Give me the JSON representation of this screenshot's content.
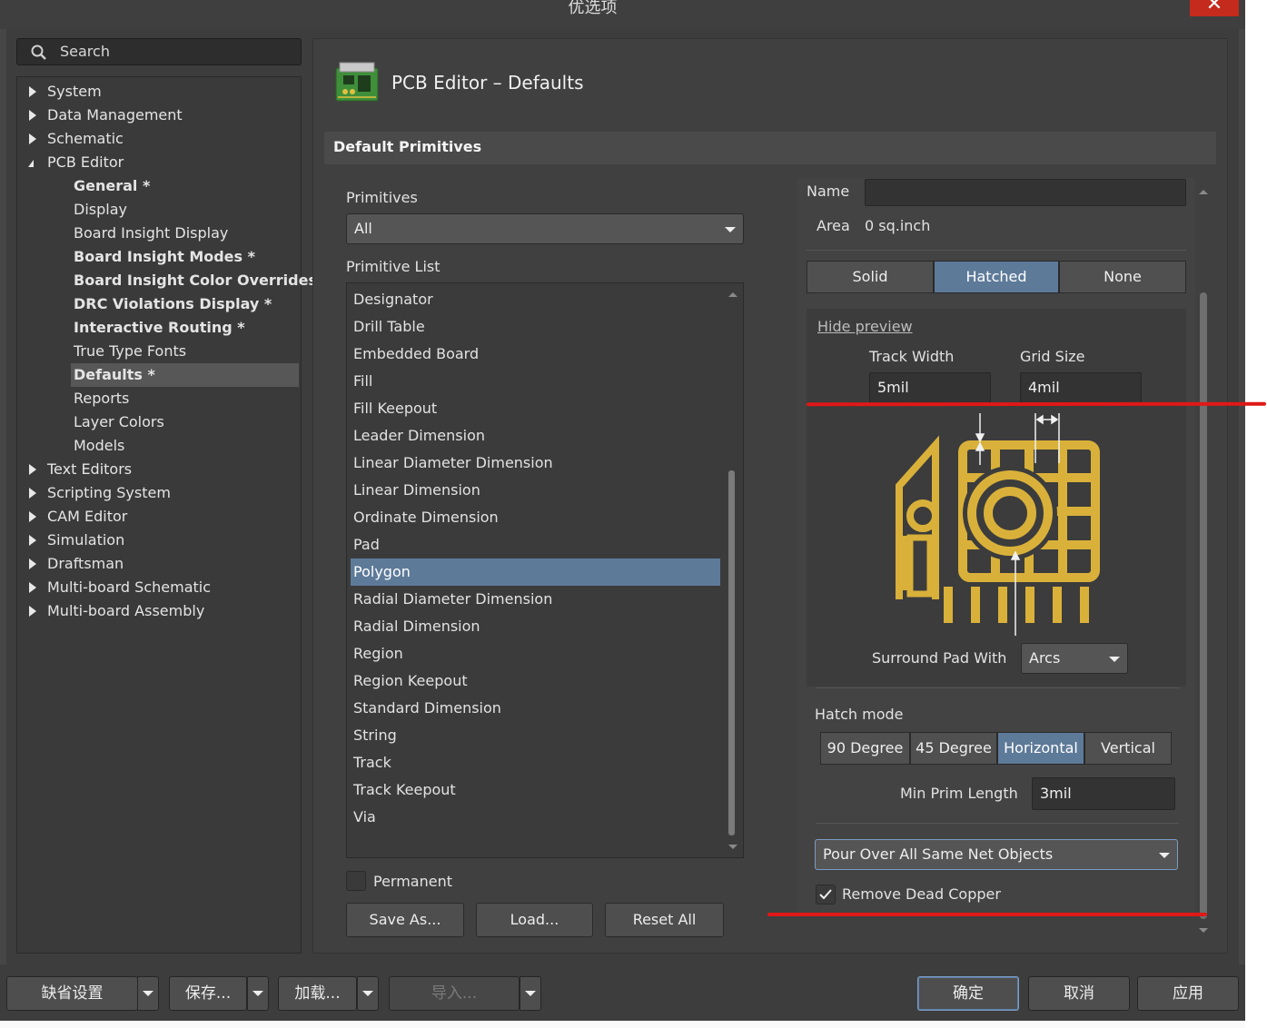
{
  "window": {
    "title": "优选项",
    "close_icon": "close-icon"
  },
  "search": {
    "placeholder": "Search"
  },
  "tree": {
    "items": [
      {
        "label": "System",
        "level": 0,
        "expandable": true,
        "expanded": false
      },
      {
        "label": "Data Management",
        "level": 0,
        "expandable": true,
        "expanded": false
      },
      {
        "label": "Schematic",
        "level": 0,
        "expandable": true,
        "expanded": false
      },
      {
        "label": "PCB Editor",
        "level": 0,
        "expandable": true,
        "expanded": true
      },
      {
        "label": "General *",
        "level": 1,
        "bold": true
      },
      {
        "label": "Display",
        "level": 1
      },
      {
        "label": "Board Insight Display",
        "level": 1
      },
      {
        "label": "Board Insight Modes *",
        "level": 1,
        "bold": true
      },
      {
        "label": "Board Insight Color Overrides *",
        "level": 1,
        "bold": true
      },
      {
        "label": "DRC Violations Display *",
        "level": 1,
        "bold": true
      },
      {
        "label": "Interactive Routing *",
        "level": 1,
        "bold": true
      },
      {
        "label": "True Type Fonts",
        "level": 1
      },
      {
        "label": "Defaults *",
        "level": 1,
        "bold": true,
        "selected": true
      },
      {
        "label": "Reports",
        "level": 1
      },
      {
        "label": "Layer Colors",
        "level": 1
      },
      {
        "label": "Models",
        "level": 1
      },
      {
        "label": "Text Editors",
        "level": 0,
        "expandable": true
      },
      {
        "label": "Scripting System",
        "level": 0,
        "expandable": true
      },
      {
        "label": "CAM Editor",
        "level": 0,
        "expandable": true
      },
      {
        "label": "Simulation",
        "level": 0,
        "expandable": true
      },
      {
        "label": "Draftsman",
        "level": 0,
        "expandable": true
      },
      {
        "label": "Multi-board Schematic",
        "level": 0,
        "expandable": true
      },
      {
        "label": "Multi-board Assembly",
        "level": 0,
        "expandable": true
      }
    ]
  },
  "page": {
    "title": "PCB Editor – Defaults",
    "section": "Default Primitives"
  },
  "primitives": {
    "label": "Primitives",
    "selected": "All",
    "list_label": "Primitive List",
    "items": [
      "Designator",
      "Drill Table",
      "Embedded Board",
      "Fill",
      "Fill Keepout",
      "Leader Dimension",
      "Linear Diameter Dimension",
      "Linear Dimension",
      "Ordinate Dimension",
      "Pad",
      "Polygon",
      "Radial Diameter Dimension",
      "Radial Dimension",
      "Region",
      "Region Keepout",
      "Standard Dimension",
      "String",
      "Track",
      "Track Keepout",
      "Via"
    ],
    "selected_item": "Polygon",
    "permanent_label": "Permanent",
    "permanent_checked": false,
    "save_as": "Save As...",
    "load": "Load...",
    "reset_all": "Reset All"
  },
  "properties": {
    "name_label": "Name",
    "name_value": "",
    "area_label": "Area",
    "area_value": "0 sq.inch",
    "fill_modes": [
      "Solid",
      "Hatched",
      "None"
    ],
    "fill_mode_selected": "Hatched",
    "hide_preview": "Hide preview",
    "track_width_label": "Track Width",
    "track_width": "5mil",
    "grid_size_label": "Grid Size",
    "grid_size": "4mil",
    "surround_label": "Surround Pad With",
    "surround_value": "Arcs",
    "hatch_mode_label": "Hatch mode",
    "hatch_modes": [
      "90 Degree",
      "45 Degree",
      "Horizontal",
      "Vertical"
    ],
    "hatch_mode_selected": "Horizontal",
    "min_prim_label": "Min Prim Length",
    "min_prim_value": "3mil",
    "pour_over": "Pour Over All Same Net Objects",
    "remove_dead_copper": "Remove Dead Copper",
    "remove_dead_copper_checked": true
  },
  "footer": {
    "defaults": "缺省设置",
    "save": "保存...",
    "load": "加载...",
    "import": "导入...",
    "ok": "确定",
    "cancel": "取消",
    "apply": "应用"
  },
  "colors": {
    "accent_selected": "#5e7a99",
    "preview_gold": "#d9b13a",
    "annotation_red": "#e01818"
  }
}
